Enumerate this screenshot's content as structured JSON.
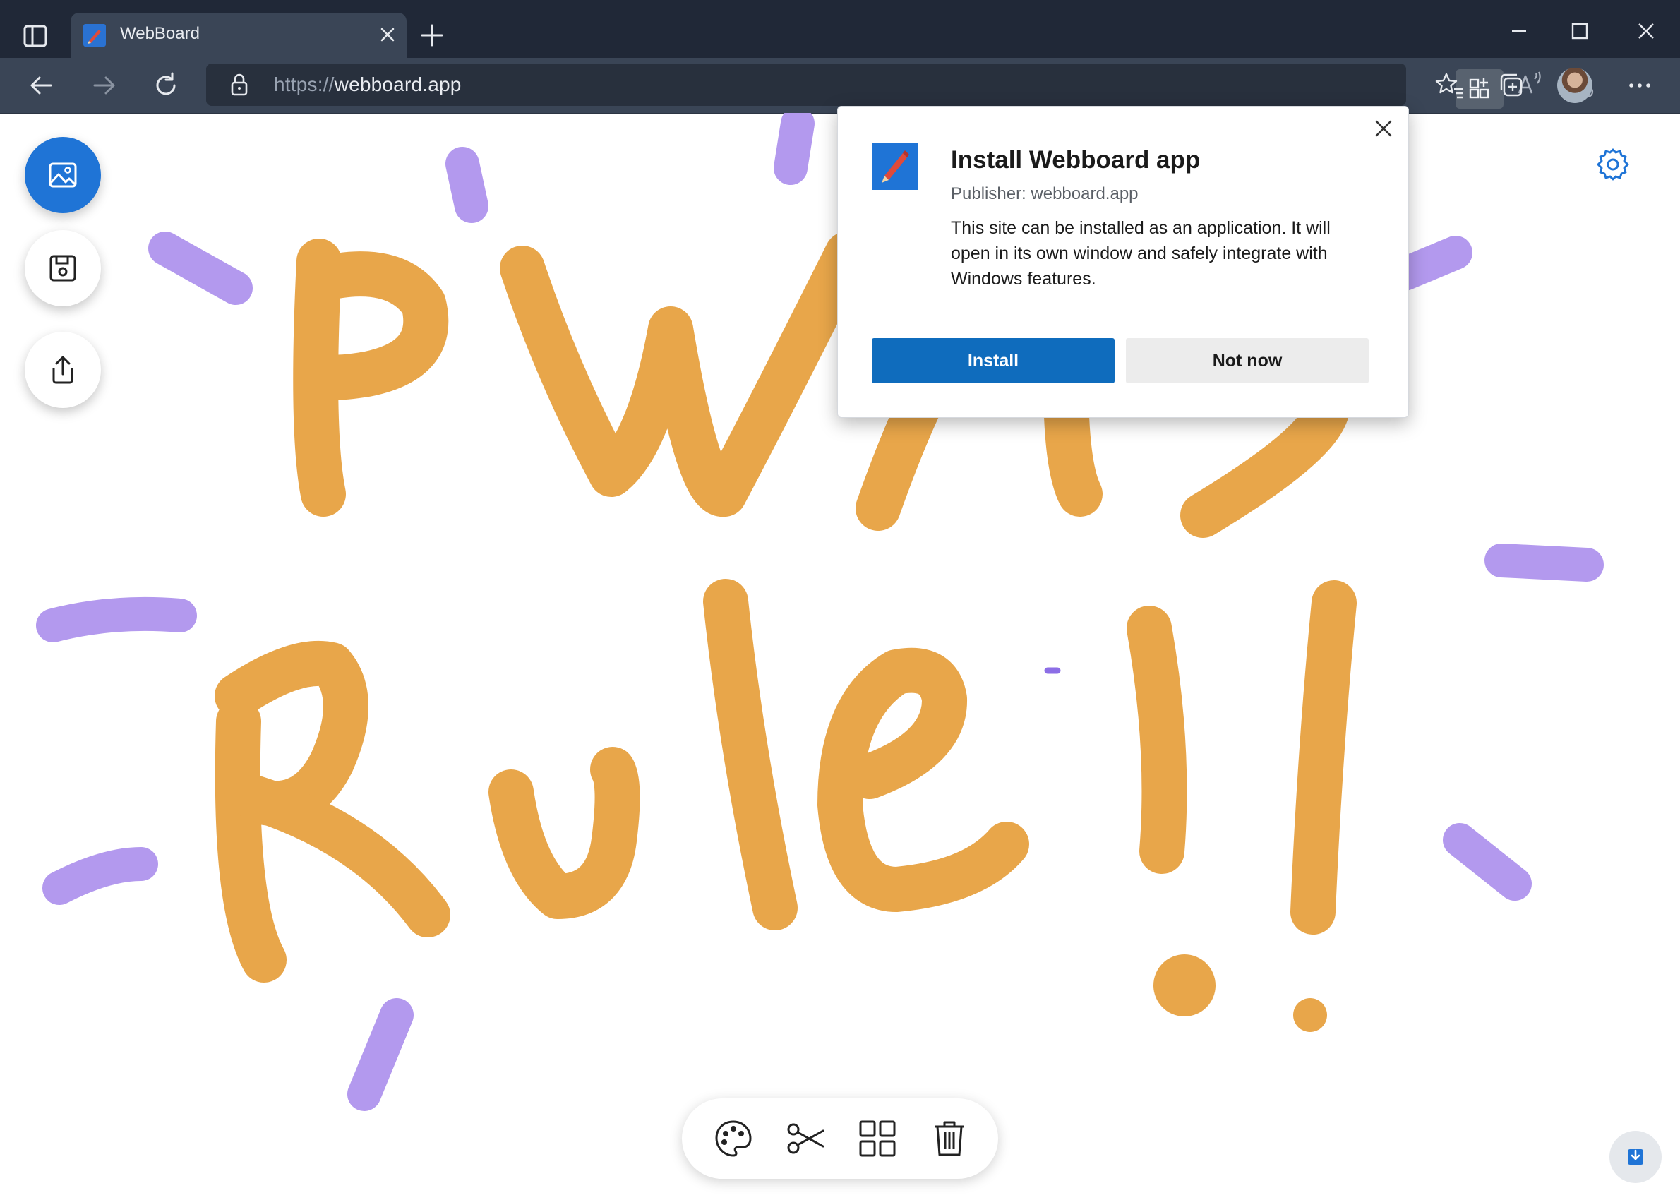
{
  "browser": {
    "tab_title": "WebBoard",
    "url_scheme": "https://",
    "url_host": "webboard.app"
  },
  "popup": {
    "title": "Install Webboard app",
    "publisher": "Publisher: webboard.app",
    "description": "This site can be installed as an application. It will open in its own window and safely integrate with Windows features.",
    "install_label": "Install",
    "not_now_label": "Not now"
  },
  "icons": {
    "left_toolbar": [
      "image-icon",
      "save-icon",
      "share-icon"
    ],
    "bottom_toolbar": [
      "palette-icon",
      "scissors-icon",
      "grid-icon",
      "trash-icon"
    ],
    "top_right": "gear-icon",
    "corner": "download-icon"
  },
  "colors": {
    "ink_orange": "#e8a64a",
    "ink_purple": "#b399ee",
    "accent_blue": "#1f74d6",
    "install_button": "#0f6cbd",
    "chrome_dark": "#202837",
    "chrome_toolbar": "#3a4556"
  }
}
